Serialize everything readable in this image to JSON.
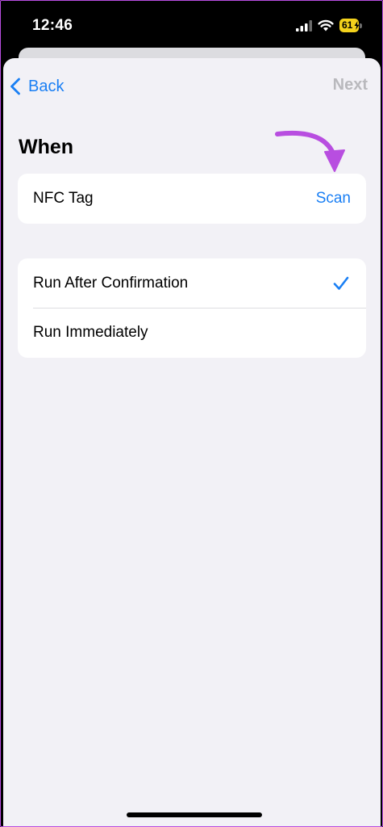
{
  "status_bar": {
    "time": "12:46",
    "battery_level": "61",
    "icons": [
      "signal-icon",
      "wifi-icon",
      "battery-icon"
    ]
  },
  "nav": {
    "back_label": "Back",
    "next_label": "Next"
  },
  "section": {
    "title": "When"
  },
  "nfc_row": {
    "label": "NFC Tag",
    "action_label": "Scan"
  },
  "run_options": [
    {
      "label": "Run After Confirmation",
      "selected": true
    },
    {
      "label": "Run Immediately",
      "selected": false
    }
  ],
  "colors": {
    "accent": "#1a7ff4",
    "disabled": "#b9b9bd",
    "sheet_background": "#f2f1f6",
    "annotation": "#b84ee0",
    "battery": "#f4d21c"
  }
}
